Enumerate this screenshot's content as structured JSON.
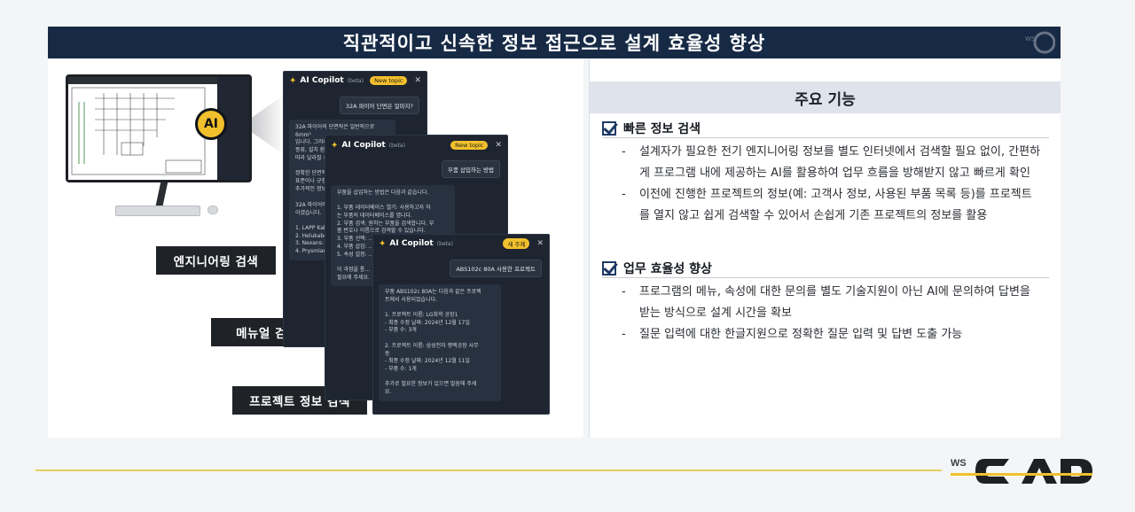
{
  "title": "직관적이고 신속한 정보 접근으로 설계 효율성 향상",
  "logo": {
    "prefix": "WS",
    "name": "CAD",
    "accent_color": "#f2c02c"
  },
  "left": {
    "ai_badge": "AI",
    "labels": {
      "engineering_search": "엔지니어링 검색",
      "manual_search": "메뉴얼 검색",
      "project_search": "프로젝트 정보 검색"
    },
    "copilot_back": {
      "title": "AI Copilot",
      "beta": "(beta)",
      "new_topic": "New topic",
      "user_question": "32A 파이어 단면은 얼마지?",
      "bot_answer": "32A 파이어의 단면적은 일반적으로 6mm²\n입니다. 그러나 이 값은 사용되는 파이어의\n종류, 설치 환경, 온도, 그리고 관련 규정에\n따라 달라질 수 있습니다.\n\n정확한 단면적을 결정하기 위해서는 해당\n표준이나 규정을 참고하고 전기공학자와\n추가적인 정보가 필요합니다.",
      "bot_answer2": "32A 파이어에 적합한 케이블은 다음과 같\n이겠습니다.\n\n1. LAPP Kabel: Ö...\n2. Helukabel: 전기...\n3. Nexans: 전선 및...\n4. Prysmian Group..."
    },
    "copilot_mid": {
      "title": "AI Copilot",
      "beta": "(beta)",
      "new_topic": "New topic",
      "user_question": "부품 삽입하는 방법",
      "bot_answer": "부품을 삽입하는 방법은 다음과 같습니다.\n\n1. 부품 데이터베이스 열기: 사용하고자 하\n는 부품의 데이터베이스를 엽니다.\n2. 부품 검색: 원하는 부품을 검색합니다. 부\n품 번호나 이름으로 검색할 수 있습니다.\n3. 부품 선택: ...\n4. 부품 삽입: ...\n5. 속성 설정: ...\n\n이 과정을 통...\n필요에 주세요."
    },
    "copilot_front": {
      "title": "AI Copilot",
      "beta": "(beta)",
      "new_topic": "새 주제",
      "user_question": "ABS102c 80A 사용한 프로젝트",
      "bot_answer": "부품 ABS102c 80A는 다음과 같은 프로젝\n트에서 사용되었습니다.\n\n1. 프로젝트 이름: LG화학 공장1\n  - 최종 수정 날짜: 2024년 12월 17일\n  - 부품 수: 3개\n\n2. 프로젝트 이름: 삼성전자 평택공장 사무\n동\n  - 최종 수정 날짜: 2024년 12월 11일\n  - 부품 수: 1개\n\n추가로 필요한 정보가 있으면 말씀해 주세\n요."
    }
  },
  "right": {
    "header": "주요 기능",
    "sections": [
      {
        "title": "빠른 정보 검색",
        "bullets": [
          "설계자가 필요한 전기 엔지니어링 정보를 별도 인터넷에서 검색할 필요 없이, 간편하게 프로그램 내에 제공하는 AI를 활용하여 업무 흐름을 방해받지 않고 빠르게 확인",
          "이전에 진행한 프로젝트의 정보(예: 고객사 정보, 사용된 부품 목록 등)를 프로젝트를 열지 않고 쉽게 검색할 수 있어서 손쉽게 기존 프로젝트의 정보를 활용"
        ]
      },
      {
        "title": "업무 효율성 향상",
        "bullets": [
          "프로그램의 메뉴, 속성에 대한 문의를 별도 기술지원이 아닌 AI에 문의하여 답변을 받는 방식으로 설계 시간을 확보",
          "질문 입력에 대한 한글지원으로 정확한 질문 입력 및 답변 도출 가능"
        ]
      }
    ]
  }
}
